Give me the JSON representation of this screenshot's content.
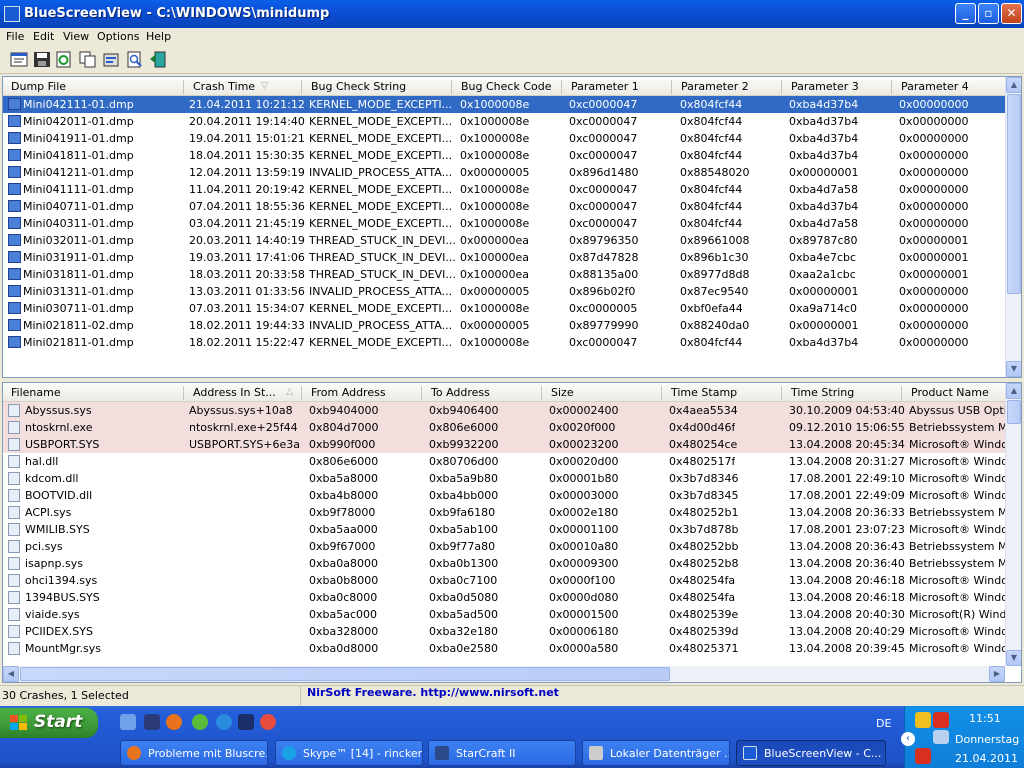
{
  "window": {
    "title": "BlueScreenView  -  C:\\WINDOWS\\minidump"
  },
  "menu": [
    "File",
    "Edit",
    "View",
    "Options",
    "Help"
  ],
  "toolbar_icons": [
    "properties-icon",
    "save-icon",
    "refresh-icon",
    "copy-icon",
    "options-icon",
    "search-icon",
    "exit-icon"
  ],
  "upper": {
    "columns": [
      "Dump File",
      "Crash Time",
      "Bug Check String",
      "Bug Check Code",
      "Parameter 1",
      "Parameter 2",
      "Parameter 3",
      "Parameter 4"
    ],
    "rows": [
      [
        "Mini042111-01.dmp",
        "21.04.2011 10:21:12",
        "KERNEL_MODE_EXCEPTI...",
        "0x1000008e",
        "0xc0000047",
        "0x804fcf44",
        "0xba4d37b4",
        "0x00000000"
      ],
      [
        "Mini042011-01.dmp",
        "20.04.2011 19:14:40",
        "KERNEL_MODE_EXCEPTI...",
        "0x1000008e",
        "0xc0000047",
        "0x804fcf44",
        "0xba4d37b4",
        "0x00000000"
      ],
      [
        "Mini041911-01.dmp",
        "19.04.2011 15:01:21",
        "KERNEL_MODE_EXCEPTI...",
        "0x1000008e",
        "0xc0000047",
        "0x804fcf44",
        "0xba4d37b4",
        "0x00000000"
      ],
      [
        "Mini041811-01.dmp",
        "18.04.2011 15:30:35",
        "KERNEL_MODE_EXCEPTI...",
        "0x1000008e",
        "0xc0000047",
        "0x804fcf44",
        "0xba4d37b4",
        "0x00000000"
      ],
      [
        "Mini041211-01.dmp",
        "12.04.2011 13:59:19",
        "INVALID_PROCESS_ATTA...",
        "0x00000005",
        "0x896d1480",
        "0x88548020",
        "0x00000001",
        "0x00000000"
      ],
      [
        "Mini041111-01.dmp",
        "11.04.2011 20:19:42",
        "KERNEL_MODE_EXCEPTI...",
        "0x1000008e",
        "0xc0000047",
        "0x804fcf44",
        "0xba4d7a58",
        "0x00000000"
      ],
      [
        "Mini040711-01.dmp",
        "07.04.2011 18:55:36",
        "KERNEL_MODE_EXCEPTI...",
        "0x1000008e",
        "0xc0000047",
        "0x804fcf44",
        "0xba4d37b4",
        "0x00000000"
      ],
      [
        "Mini040311-01.dmp",
        "03.04.2011 21:45:19",
        "KERNEL_MODE_EXCEPTI...",
        "0x1000008e",
        "0xc0000047",
        "0x804fcf44",
        "0xba4d7a58",
        "0x00000000"
      ],
      [
        "Mini032011-01.dmp",
        "20.03.2011 14:40:19",
        "THREAD_STUCK_IN_DEVI...",
        "0x000000ea",
        "0x89796350",
        "0x89661008",
        "0x89787c80",
        "0x00000001"
      ],
      [
        "Mini031911-01.dmp",
        "19.03.2011 17:41:06",
        "THREAD_STUCK_IN_DEVI...",
        "0x100000ea",
        "0x87d47828",
        "0x896b1c30",
        "0xba4e7cbc",
        "0x00000001"
      ],
      [
        "Mini031811-01.dmp",
        "18.03.2011 20:33:58",
        "THREAD_STUCK_IN_DEVI...",
        "0x100000ea",
        "0x88135a00",
        "0x8977d8d8",
        "0xaa2a1cbc",
        "0x00000001"
      ],
      [
        "Mini031311-01.dmp",
        "13.03.2011 01:33:56",
        "INVALID_PROCESS_ATTA...",
        "0x00000005",
        "0x896b02f0",
        "0x87ec9540",
        "0x00000001",
        "0x00000000"
      ],
      [
        "Mini030711-01.dmp",
        "07.03.2011 15:34:07",
        "KERNEL_MODE_EXCEPTI...",
        "0x1000008e",
        "0xc0000005",
        "0xbf0efa44",
        "0xa9a714c0",
        "0x00000000"
      ],
      [
        "Mini021811-02.dmp",
        "18.02.2011 19:44:33",
        "INVALID_PROCESS_ATTA...",
        "0x00000005",
        "0x89779990",
        "0x88240da0",
        "0x00000001",
        "0x00000000"
      ],
      [
        "Mini021811-01.dmp",
        "18.02.2011 15:22:47",
        "KERNEL_MODE_EXCEPTI...",
        "0x1000008e",
        "0xc0000047",
        "0x804fcf44",
        "0xba4d37b4",
        "0x00000000"
      ]
    ]
  },
  "lower": {
    "columns": [
      "Filename",
      "Address In St...",
      "From Address",
      "To Address",
      "Size",
      "Time Stamp",
      "Time String",
      "Product Name"
    ],
    "rows": [
      [
        "Abyssus.sys",
        "Abyssus.sys+10a8",
        "0xb9404000",
        "0xb9406400",
        "0x00002400",
        "0x4aea5534",
        "30.10.2009 04:53:40",
        "Abyssus USB Optica..."
      ],
      [
        "ntoskrnl.exe",
        "ntoskrnl.exe+25f44",
        "0x804d7000",
        "0x806e6000",
        "0x0020f000",
        "0x4d00d46f",
        "09.12.2010 15:06:55",
        "Betriebssystem Micr..."
      ],
      [
        "USBPORT.SYS",
        "USBPORT.SYS+6e3a",
        "0xb990f000",
        "0xb9932200",
        "0x00023200",
        "0x480254ce",
        "13.04.2008 20:45:34",
        "Microsoft® Window..."
      ],
      [
        "hal.dll",
        "",
        "0x806e6000",
        "0x80706d00",
        "0x00020d00",
        "0x4802517f",
        "13.04.2008 20:31:27",
        "Microsoft® Window..."
      ],
      [
        "kdcom.dll",
        "",
        "0xba5a8000",
        "0xba5a9b80",
        "0x00001b80",
        "0x3b7d8346",
        "17.08.2001 22:49:10",
        "Microsoft® Window..."
      ],
      [
        "BOOTVID.dll",
        "",
        "0xba4b8000",
        "0xba4bb000",
        "0x00003000",
        "0x3b7d8345",
        "17.08.2001 22:49:09",
        "Microsoft® Window..."
      ],
      [
        "ACPI.sys",
        "",
        "0xb9f78000",
        "0xb9fa6180",
        "0x0002e180",
        "0x480252b1",
        "13.04.2008 20:36:33",
        "Betriebssystem Micr..."
      ],
      [
        "WMILIB.SYS",
        "",
        "0xba5aa000",
        "0xba5ab100",
        "0x00001100",
        "0x3b7d878b",
        "17.08.2001 23:07:23",
        "Microsoft® Window..."
      ],
      [
        "pci.sys",
        "",
        "0xb9f67000",
        "0xb9f77a80",
        "0x00010a80",
        "0x480252bb",
        "13.04.2008 20:36:43",
        "Betriebssystem Micr..."
      ],
      [
        "isapnp.sys",
        "",
        "0xba0a8000",
        "0xba0b1300",
        "0x00009300",
        "0x480252b8",
        "13.04.2008 20:36:40",
        "Betriebssystem Micr..."
      ],
      [
        "ohci1394.sys",
        "",
        "0xba0b8000",
        "0xba0c7100",
        "0x0000f100",
        "0x480254fa",
        "13.04.2008 20:46:18",
        "Microsoft® Window..."
      ],
      [
        "1394BUS.SYS",
        "",
        "0xba0c8000",
        "0xba0d5080",
        "0x0000d080",
        "0x480254fa",
        "13.04.2008 20:46:18",
        "Microsoft® Window..."
      ],
      [
        "viaide.sys",
        "",
        "0xba5ac000",
        "0xba5ad500",
        "0x00001500",
        "0x4802539e",
        "13.04.2008 20:40:30",
        "Microsoft(R) Windo..."
      ],
      [
        "PCIIDEX.SYS",
        "",
        "0xba328000",
        "0xba32e180",
        "0x00006180",
        "0x4802539d",
        "13.04.2008 20:40:29",
        "Microsoft® Window..."
      ],
      [
        "MountMgr.sys",
        "",
        "0xba0d8000",
        "0xba0e2580",
        "0x0000a580",
        "0x48025371",
        "13.04.2008 20:39:45",
        "Microsoft® Window..."
      ]
    ]
  },
  "status": {
    "left": "30 Crashes, 1 Selected",
    "link": "NirSoft Freeware.  http://www.nirsoft.net"
  },
  "taskbar": {
    "start": "Start",
    "tasks": [
      "Probleme mit Bluscre...",
      "Skype™ [14] - rincker1",
      "StarCraft II",
      "Lokaler Datenträger ...",
      "BlueScreenView - C..."
    ],
    "lang": "DE",
    "time": "11:51",
    "day": "Donnerstag",
    "date": "21.04.2011"
  }
}
